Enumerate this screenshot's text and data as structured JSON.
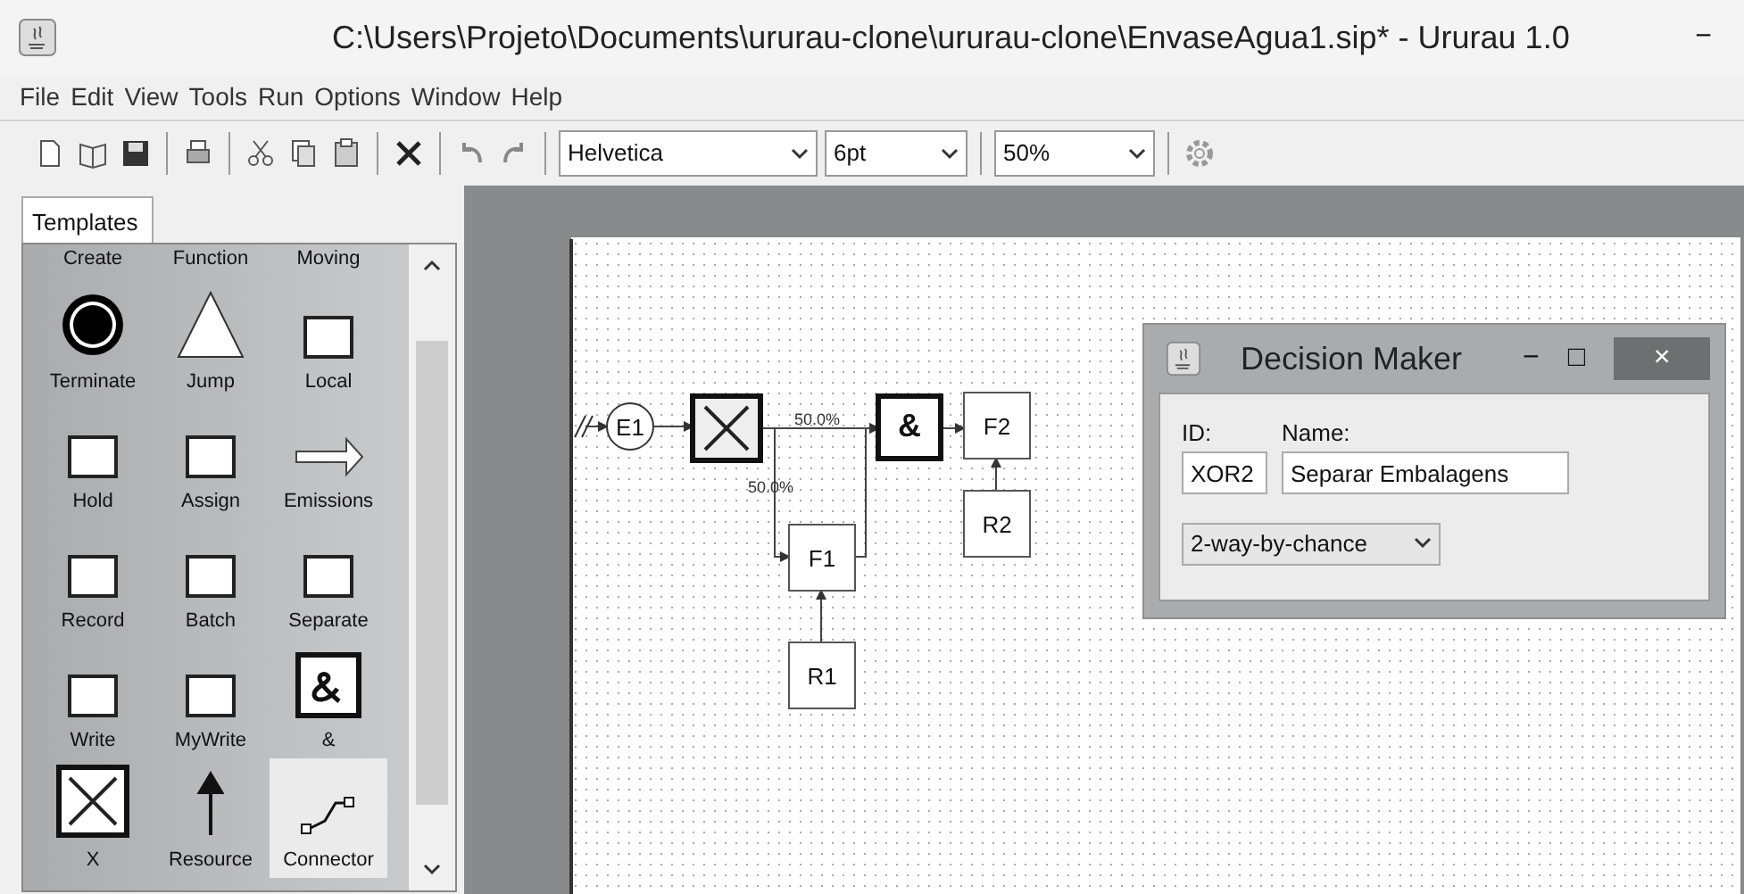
{
  "window": {
    "title": "C:\\Users\\Projeto\\Documents\\ururau-clone\\ururau-clone\\EnvaseAgua1.sip* - Ururau 1.0",
    "controls": [
      "−"
    ]
  },
  "menu": [
    "File",
    "Edit",
    "View",
    "Tools",
    "Run",
    "Options",
    "Window",
    "Help"
  ],
  "toolbar": {
    "font": "Helvetica",
    "size": "6pt",
    "zoom": "50%"
  },
  "palette": {
    "tab": "Templates",
    "items": [
      {
        "label": "Create",
        "kind": "none",
        "selected": false
      },
      {
        "label": "Function",
        "kind": "none",
        "selected": false
      },
      {
        "label": "Moving",
        "kind": "none",
        "selected": false
      },
      {
        "label": "Terminate",
        "kind": "terminate",
        "selected": false
      },
      {
        "label": "Jump",
        "kind": "triangle",
        "selected": false
      },
      {
        "label": "Local",
        "kind": "box",
        "selected": false
      },
      {
        "label": "Hold",
        "kind": "box",
        "selected": false
      },
      {
        "label": "Assign",
        "kind": "box",
        "selected": false
      },
      {
        "label": "Emissions",
        "kind": "arrow",
        "selected": false
      },
      {
        "label": "Record",
        "kind": "box",
        "selected": false
      },
      {
        "label": "Batch",
        "kind": "box",
        "selected": false
      },
      {
        "label": "Separate",
        "kind": "box",
        "selected": false
      },
      {
        "label": "Write",
        "kind": "box",
        "selected": false
      },
      {
        "label": "MyWrite",
        "kind": "box",
        "selected": false
      },
      {
        "label": "&",
        "kind": "and",
        "selected": false
      },
      {
        "label": "X",
        "kind": "xor",
        "selected": false
      },
      {
        "label": "Resource",
        "kind": "resource",
        "selected": false
      },
      {
        "label": "Connector",
        "kind": "connector",
        "selected": true
      }
    ]
  },
  "diagram": {
    "nodes": [
      {
        "kind": "entry",
        "label": "E1"
      },
      {
        "kind": "xor"
      },
      {
        "kind": "and",
        "label": "&"
      },
      {
        "kind": "function",
        "label": "F2"
      },
      {
        "kind": "function",
        "label": "F1"
      },
      {
        "kind": "function",
        "label": "R1"
      },
      {
        "kind": "function",
        "label": "R2"
      }
    ],
    "edge_labels": [
      "50.0%",
      "50.0%"
    ]
  },
  "dialog": {
    "title": "Decision Maker",
    "controls": [
      "−",
      "□",
      "×"
    ],
    "id_label": "ID:",
    "id": "XOR2",
    "name_label": "Name:",
    "name": "Separar Embalagens",
    "mode": "2-way-by-chance"
  }
}
